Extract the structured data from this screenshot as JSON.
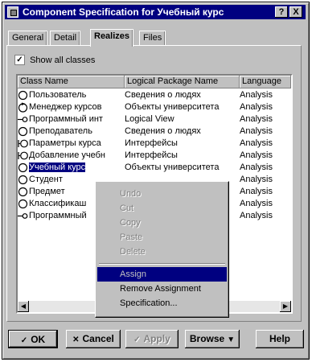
{
  "window": {
    "title": "Component Specification for Учебный курс",
    "help_button": "?",
    "close_button": "X"
  },
  "tabs": [
    {
      "label": "General"
    },
    {
      "label": "Detail"
    },
    {
      "label": "Realizes"
    },
    {
      "label": "Files"
    }
  ],
  "show_all_classes": {
    "label": "Show all classes",
    "checked": true
  },
  "columns": [
    "Class Name",
    "Logical Package Name",
    "Language"
  ],
  "rows": [
    {
      "name": "Пользователь",
      "package": "Сведения о людях",
      "language": "Analysis",
      "icon": "class-icon"
    },
    {
      "name": "Менеджер курсов",
      "package": "Объекты университета",
      "language": "Analysis",
      "icon": "control-class-icon"
    },
    {
      "name": "Программный инт",
      "package": "Logical View",
      "language": "Analysis",
      "icon": "interface-icon"
    },
    {
      "name": "Преподаватель",
      "package": "Сведения о людях",
      "language": "Analysis",
      "icon": "class-icon"
    },
    {
      "name": "Параметры курса",
      "package": "Интерфейсы",
      "language": "Analysis",
      "icon": "boundary-class-icon"
    },
    {
      "name": "Добавление учебн",
      "package": "Интерфейсы",
      "language": "Analysis",
      "icon": "boundary-class-icon"
    },
    {
      "name": "Учебный курс",
      "package": "Объекты университета",
      "language": "Analysis",
      "icon": "class-icon"
    },
    {
      "name": "Студент",
      "package": "",
      "language": "Analysis",
      "icon": "class-icon"
    },
    {
      "name": "Предмет",
      "package": "",
      "language": "Analysis",
      "icon": "class-icon"
    },
    {
      "name": "Классификаш",
      "package": "",
      "language": "Analysis",
      "icon": "class-icon"
    },
    {
      "name": "Программный",
      "package": "",
      "language": "Analysis",
      "icon": "interface-icon"
    }
  ],
  "context_menu": {
    "items": [
      {
        "label": "Undo",
        "enabled": false
      },
      {
        "label": "Cut",
        "enabled": false
      },
      {
        "label": "Copy",
        "enabled": false
      },
      {
        "label": "Paste",
        "enabled": false
      },
      {
        "label": "Delete",
        "enabled": false
      },
      {
        "label": "Assign",
        "enabled": true,
        "highlighted": true
      },
      {
        "label": "Remove Assignment",
        "enabled": true
      },
      {
        "label": "Specification...",
        "enabled": true
      }
    ]
  },
  "buttons": {
    "ok": "OK",
    "cancel": "Cancel",
    "apply": "Apply",
    "browse": "Browse",
    "help": "Help"
  },
  "colors": {
    "titlebar": "#000080",
    "face": "#c0c0c0",
    "highlight": "#000080"
  }
}
